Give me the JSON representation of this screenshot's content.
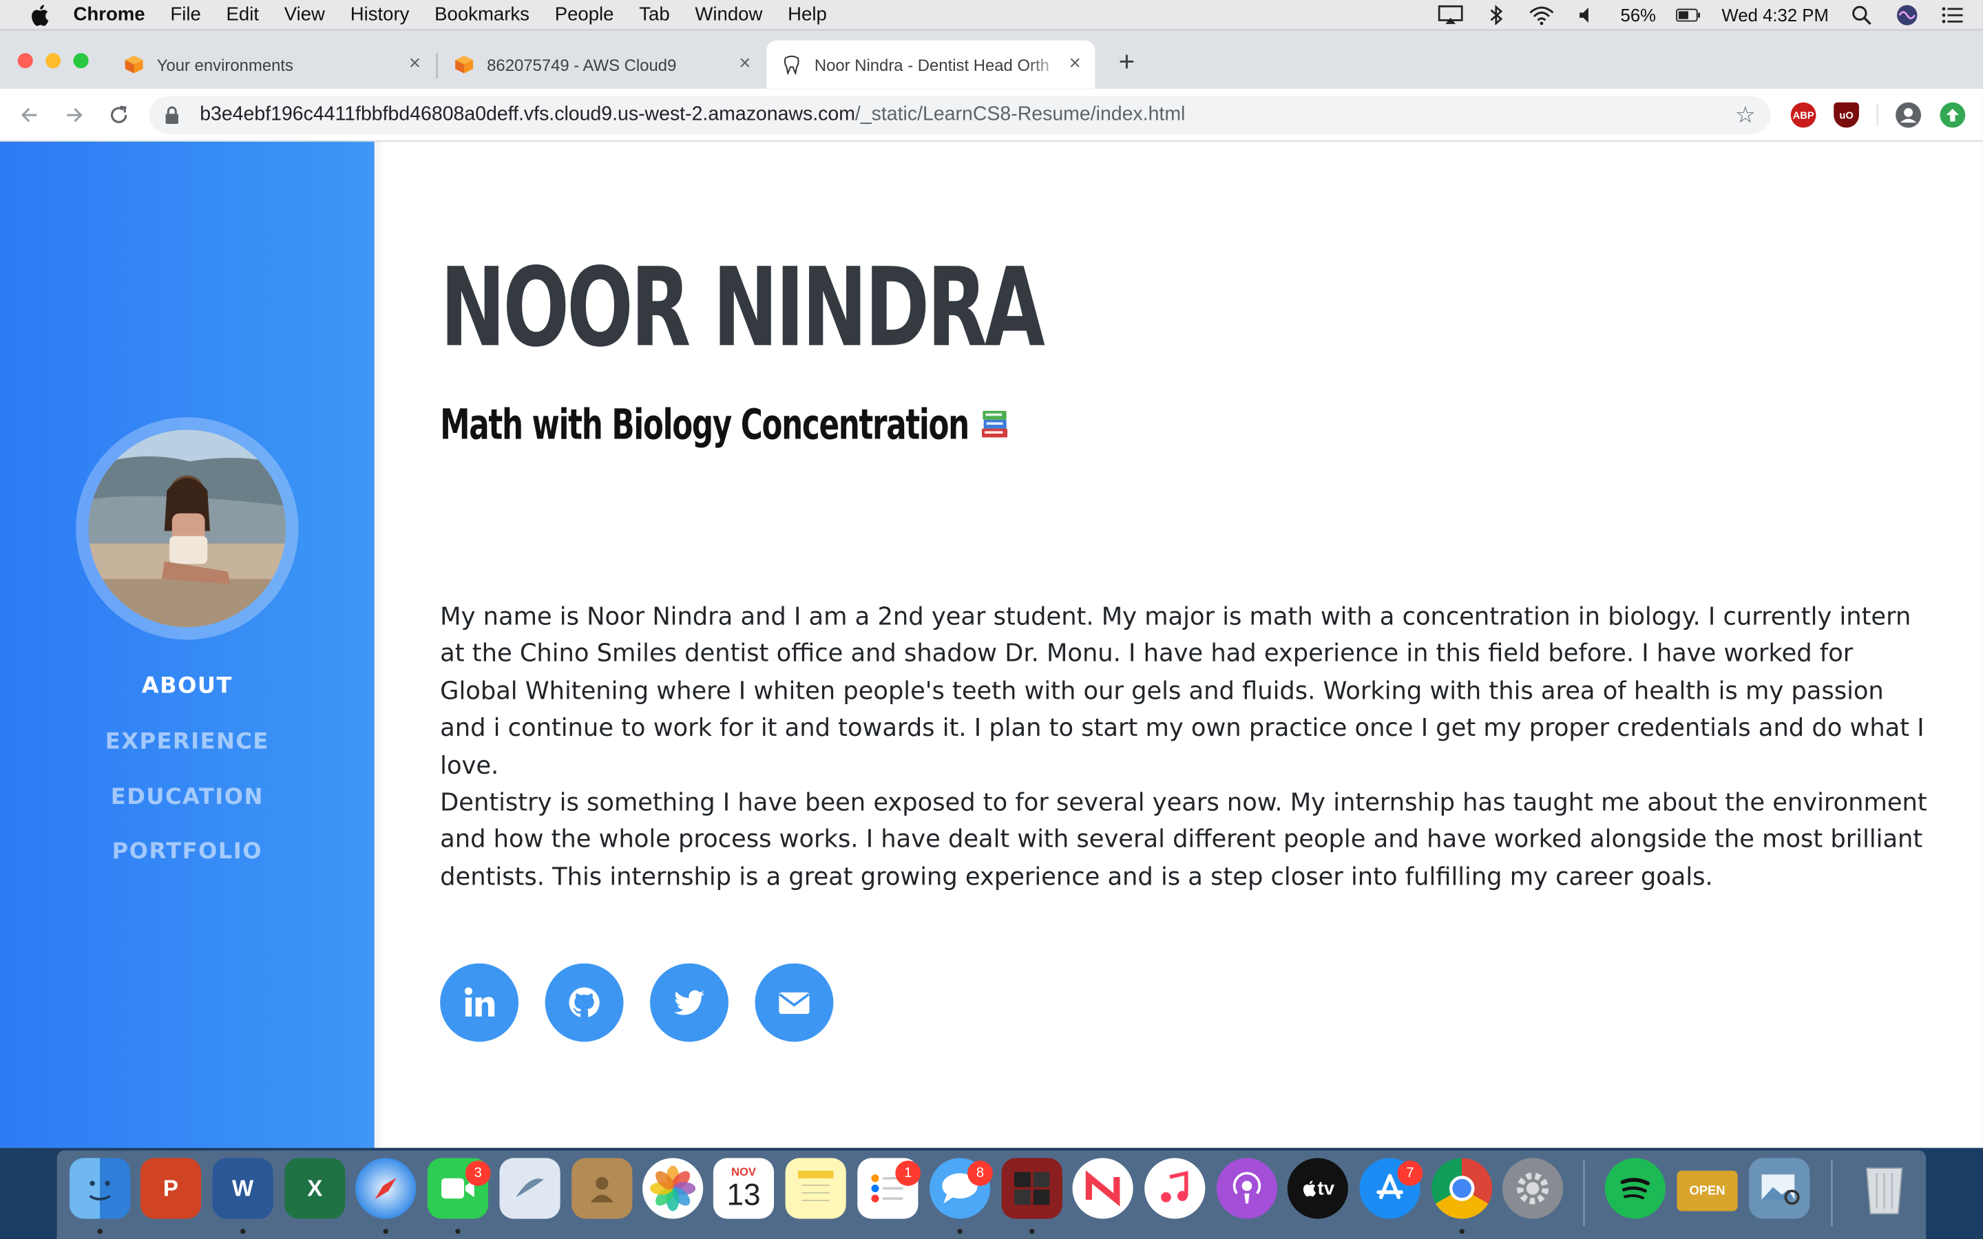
{
  "menubar": {
    "app_name": "Chrome",
    "items": [
      "File",
      "Edit",
      "View",
      "History",
      "Bookmarks",
      "People",
      "Tab",
      "Window",
      "Help"
    ],
    "battery": "56%",
    "clock": "Wed 4:32 PM"
  },
  "tabs": [
    {
      "title": "Your environments",
      "icon": "aws-cube-icon"
    },
    {
      "title": "862075749 - AWS Cloud9",
      "icon": "aws-cube-icon"
    },
    {
      "title": "Noor Nindra - Dentist Head Orth",
      "icon": "tooth-icon",
      "active": true
    }
  ],
  "omnibox": {
    "host": "b3e4ebf196c4411fbbfbd46808a0deff.vfs.cloud9.us-west-2.amazonaws.com",
    "path": "/_static/LearnCS8-Resume/index.html"
  },
  "extensions": {
    "abp": "ABP",
    "ublock": "uO"
  },
  "sidebar": {
    "nav": [
      "ABOUT",
      "EXPERIENCE",
      "EDUCATION",
      "PORTFOLIO"
    ],
    "active": "ABOUT"
  },
  "main": {
    "name": "NOOR NINDRA",
    "subtitle": "Math with Biology Concentration",
    "paragraphs": [
      "My name is Noor Nindra and I am a 2nd year student. My major is math with a concentration in biology. I currently intern at the Chino Smiles dentist office and shadow Dr. Monu. I have had experience in this field before. I have worked for Global Whitening where I whiten people's teeth with our gels and fluids. Working with this area of health is my passion and i continue to work for it and towards it. I plan to start my own practice once I get my proper credentials and do what I love.",
      "Dentistry is something I have been exposed to for several years now. My internship has taught me about the environment and how the whole process works. I have dealt with several different people and have worked alongside the most brilliant dentists. This internship is a great growing experience and is a step closer into fulfilling my career goals."
    ],
    "social": [
      "linkedin-icon",
      "github-icon",
      "twitter-icon",
      "envelope-icon"
    ]
  },
  "dock": {
    "badges": {
      "facetime": "3",
      "reminders": "1",
      "messages": "8",
      "appstore": "7"
    },
    "calendar_month": "NOV",
    "calendar_day": "13",
    "open_sign": "OPEN",
    "tv_label": "tv"
  },
  "colors": {
    "sidebar_start": "#2d7bf5",
    "sidebar_end": "#3e97f5",
    "accent": "#3d96f2",
    "heading": "#343a40"
  }
}
